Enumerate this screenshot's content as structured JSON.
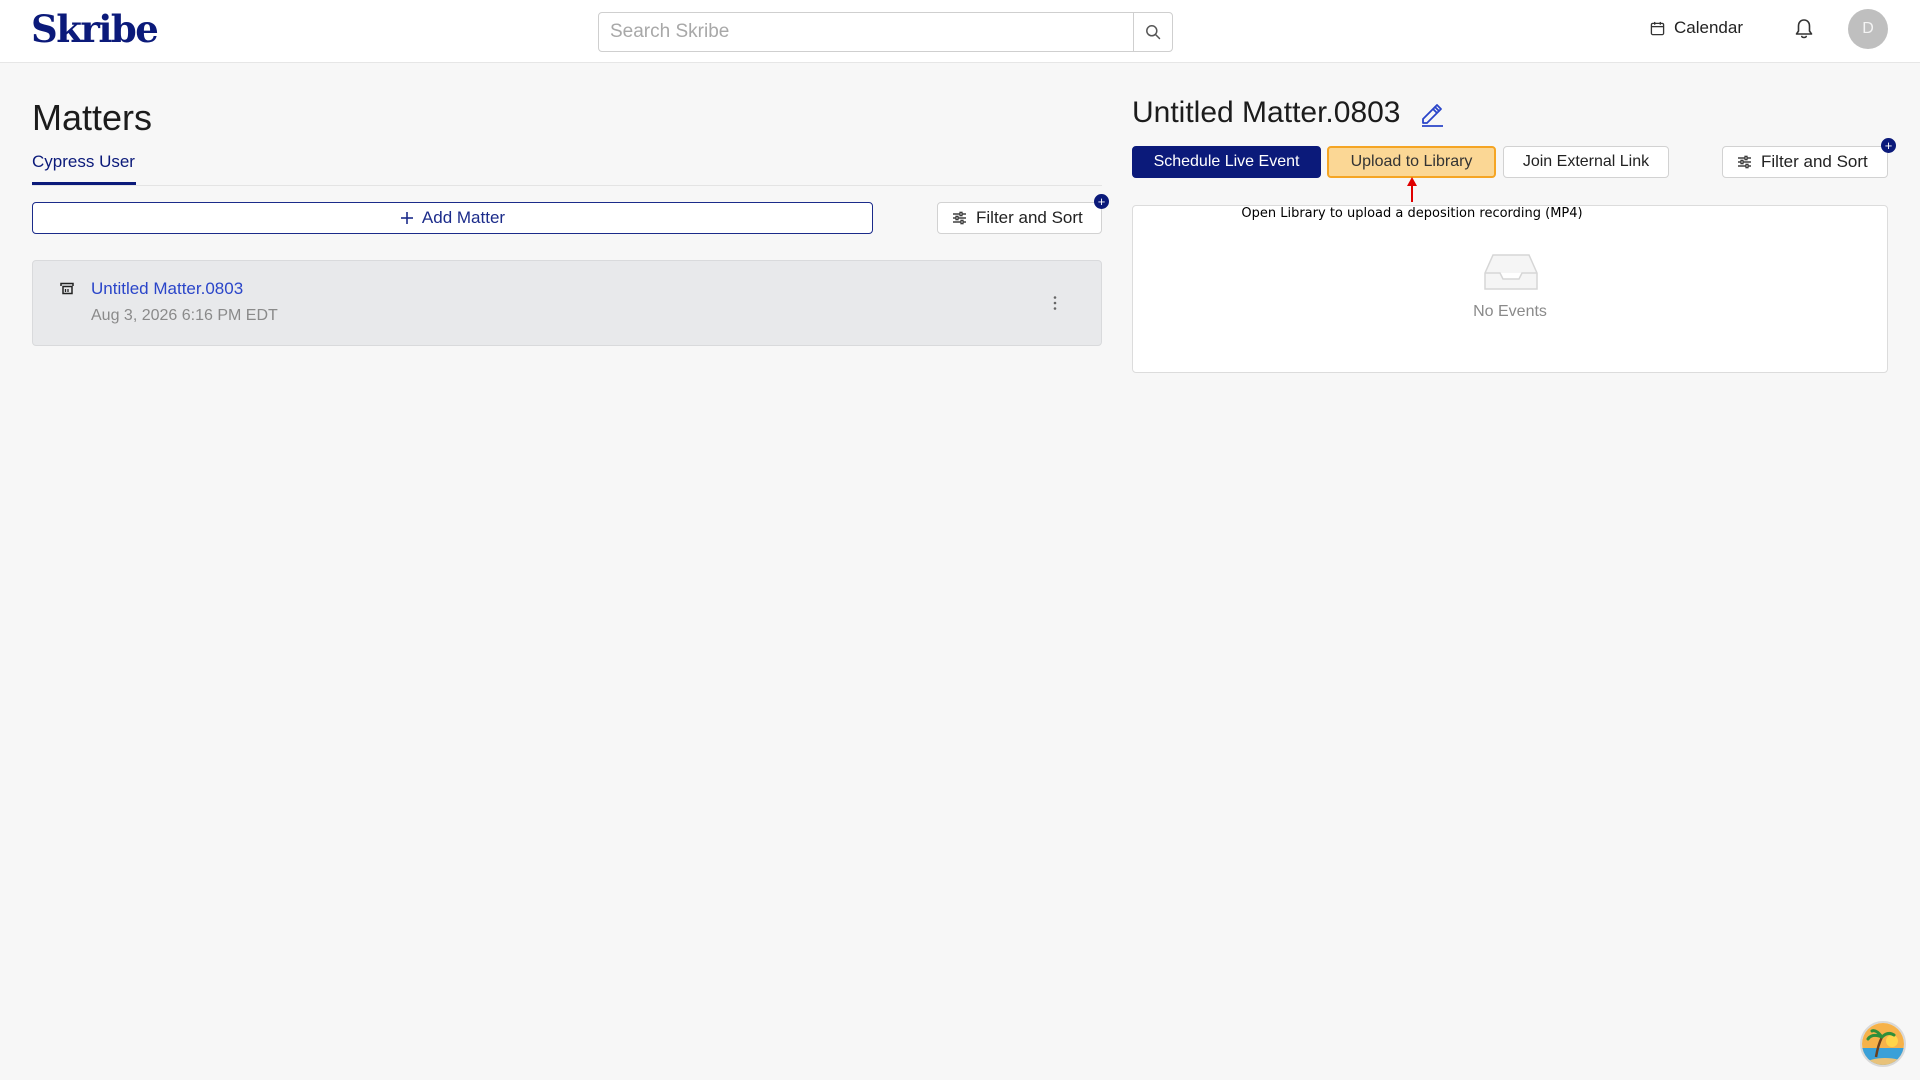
{
  "header": {
    "logo_text": "Skribe",
    "search_placeholder": "Search Skribe",
    "calendar_label": "Calendar",
    "avatar_initial": "D"
  },
  "left": {
    "title": "Matters",
    "tab_label": "Cypress User",
    "add_matter_label": "Add Matter",
    "filter_label": "Filter and Sort",
    "filter_badge": "+",
    "matters": [
      {
        "name": "Untitled Matter.0803",
        "date": "Aug 3, 2026 6:16 PM EDT"
      }
    ]
  },
  "right": {
    "title": "Untitled Matter.0803",
    "schedule_label": "Schedule Live Event",
    "upload_label": "Upload to Library",
    "join_label": "Join External Link",
    "filter_label": "Filter and Sort",
    "filter_badge": "+",
    "hint_text": "Open Library to upload a deposition recording (MP4)",
    "empty_text": "No Events"
  },
  "colors": {
    "brand": "#0b1a7a",
    "link": "#2a45c9",
    "highlight_fill": "#fbd795",
    "highlight_border": "#f5a524",
    "annotation_arrow": "#e00000"
  },
  "icons": [
    "search-icon",
    "calendar-icon",
    "bell-icon",
    "plus-icon",
    "sliders-icon",
    "matter-icon",
    "kebab-icon",
    "pencil-icon",
    "inbox-icon",
    "assistant-icon"
  ]
}
